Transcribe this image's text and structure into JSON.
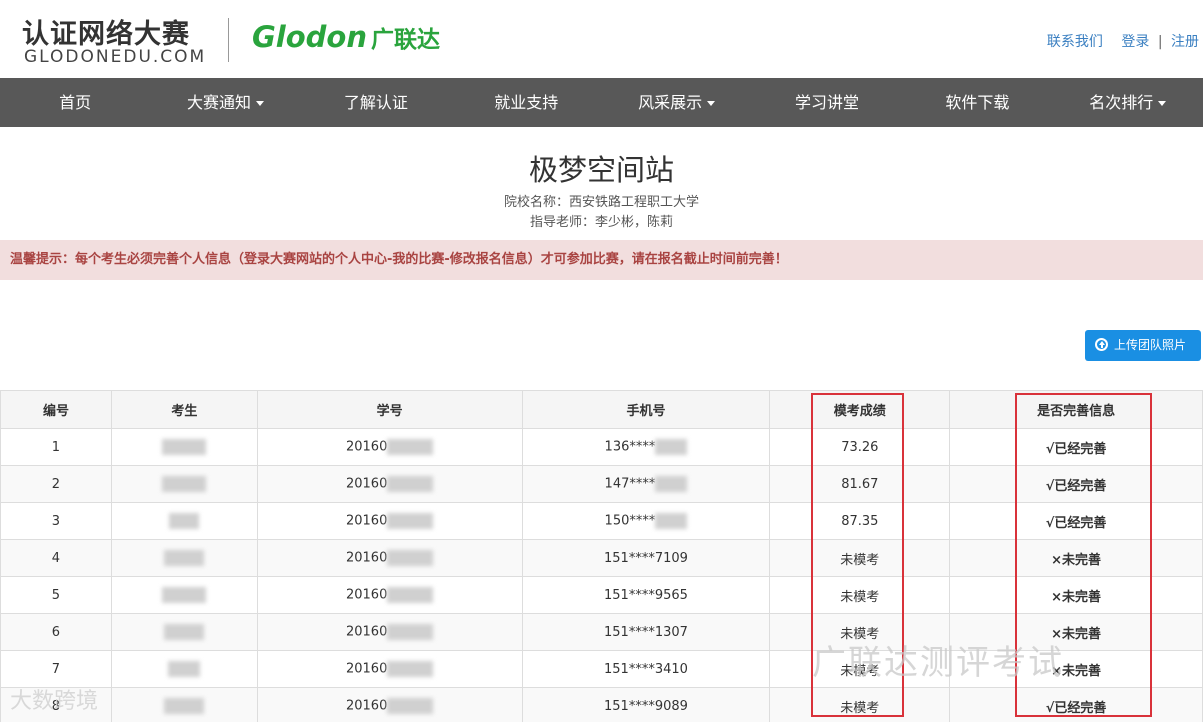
{
  "header": {
    "logo_cn": "认证网络大赛",
    "logo_en": "GLODONEDU.COM",
    "brand_en": "Glodon",
    "brand_cn": "广联达",
    "links": {
      "contact": "联系我们",
      "login": "登录",
      "separator": "|",
      "register": "注册"
    }
  },
  "nav": [
    {
      "label": "首页",
      "dropdown": false
    },
    {
      "label": "大赛通知",
      "dropdown": true
    },
    {
      "label": "了解认证",
      "dropdown": false
    },
    {
      "label": "就业支持",
      "dropdown": false
    },
    {
      "label": "风采展示",
      "dropdown": true
    },
    {
      "label": "学习讲堂",
      "dropdown": false
    },
    {
      "label": "软件下载",
      "dropdown": false
    },
    {
      "label": "名次排行",
      "dropdown": true
    }
  ],
  "team": {
    "name": "极梦空间站",
    "school": "院校名称：西安铁路工程职工大学",
    "teacher": "指导老师：李少彬，陈莉"
  },
  "alert": "温馨提示：每个考生必须完善个人信息（登录大赛网站的个人中心-我的比赛-修改报名信息）才可参加比赛，请在报名截止时间前完善！",
  "upload_button": "上传团队照片",
  "table": {
    "headers": [
      "编号",
      "考生",
      "学号",
      "手机号",
      "模考成绩",
      "是否完善信息"
    ],
    "rows": [
      {
        "no": "1",
        "id": "20160",
        "phone": "136****",
        "score": "73.26",
        "status": "√已经完善",
        "done": true
      },
      {
        "no": "2",
        "id": "20160",
        "phone": "147****",
        "score": "81.67",
        "status": "√已经完善",
        "done": true
      },
      {
        "no": "3",
        "id": "20160",
        "phone": "150****",
        "score": "87.35",
        "status": "√已经完善",
        "done": true
      },
      {
        "no": "4",
        "id": "20160",
        "phone": "151****7109",
        "score": "未模考",
        "status": "×未完善",
        "done": false
      },
      {
        "no": "5",
        "id": "20160",
        "phone": "151****9565",
        "score": "未模考",
        "status": "×未完善",
        "done": false
      },
      {
        "no": "6",
        "id": "20160",
        "phone": "151****1307",
        "score": "未模考",
        "status": "×未完善",
        "done": false
      },
      {
        "no": "7",
        "id": "20160",
        "phone": "151****3410",
        "score": "未模考",
        "status": "×未完善",
        "done": false
      },
      {
        "no": "8",
        "id": "20160",
        "phone": "151****9089",
        "score": "未模考",
        "status": "√已经完善",
        "done": true
      }
    ]
  },
  "watermarks": {
    "right": "广联达测评考试",
    "left": "大数跨境"
  },
  "colors": {
    "nav_bg": "#585858",
    "brand_green": "#2aa43d",
    "link_blue": "#3a7fc1",
    "alert_bg": "#f2dede",
    "ok_green": "#2a9d2a",
    "no_red": "#e02424",
    "button_blue": "#1a8fe3",
    "highlight_red": "#d9323a"
  }
}
